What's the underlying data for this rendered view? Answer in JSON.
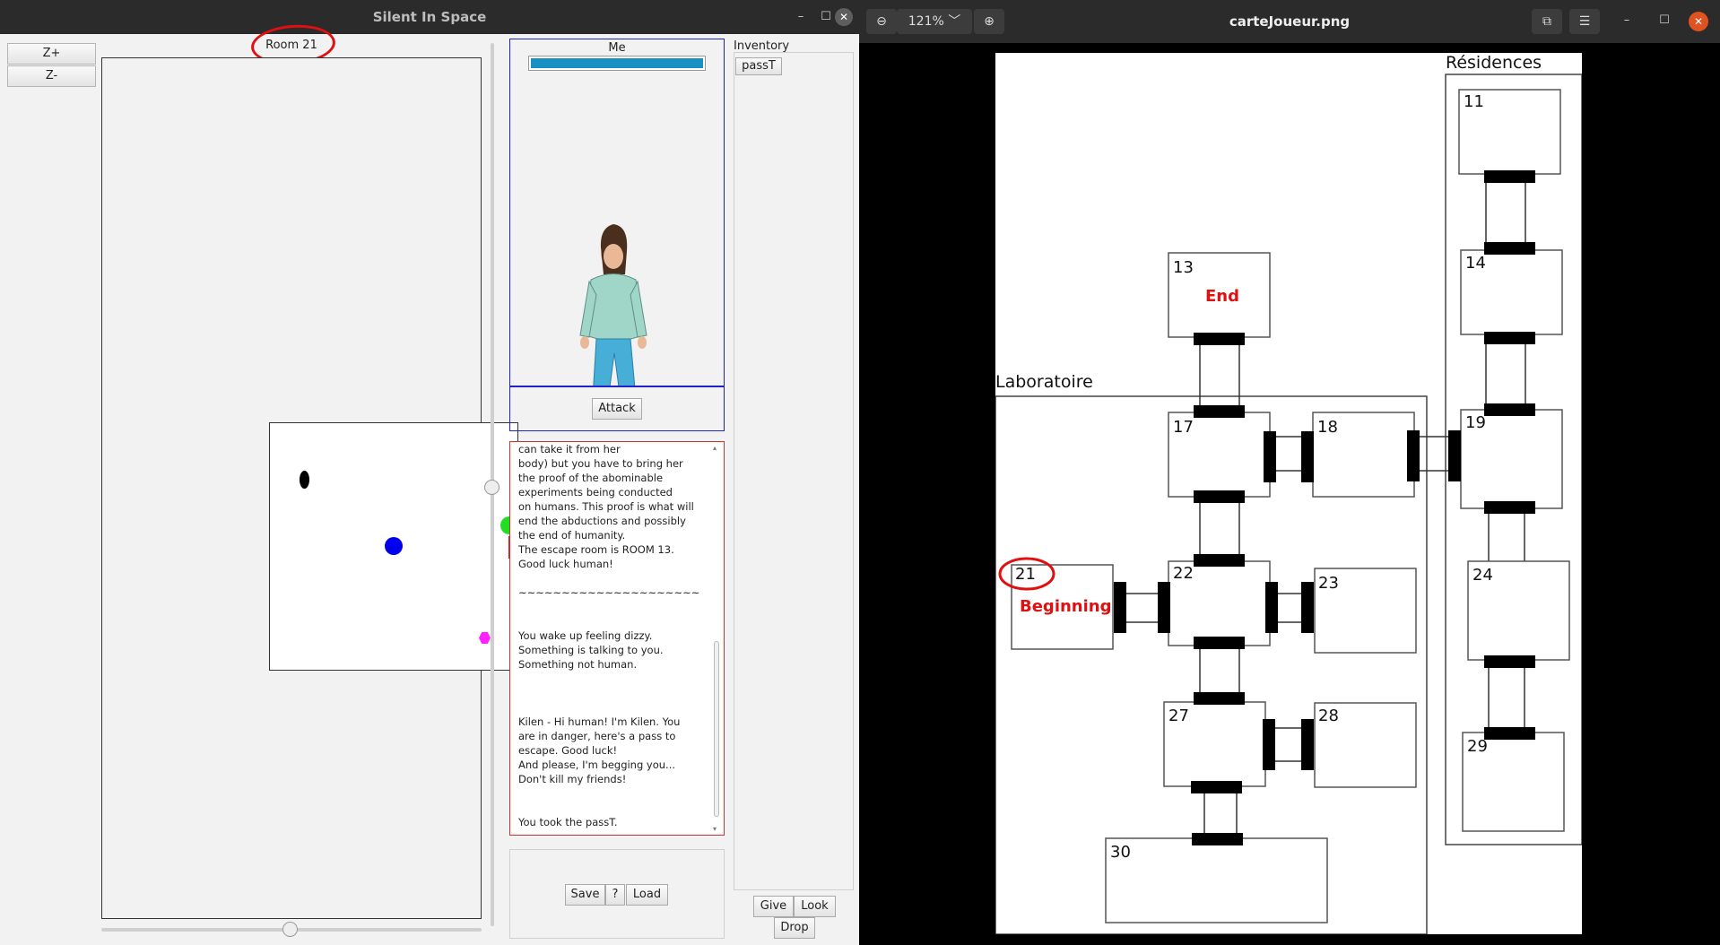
{
  "game_window": {
    "title": "Silent In Space",
    "zoom_in_label": "Z+",
    "zoom_out_label": "Z-",
    "room_label": "Room 21",
    "character_name": "Me",
    "health_fraction": 1.0,
    "attack_label": "Attack",
    "inventory_label": "Inventory",
    "inventory_items": [
      "passT"
    ],
    "save_label": "Save",
    "help_label": "?",
    "load_label": "Load",
    "give_label": "Give",
    "look_label": "Look",
    "drop_label": "Drop",
    "log_lines": [
      "can take it from her",
      "body) but you have to bring her",
      "the proof of the abominable",
      "experiments being conducted",
      "on humans. This proof is what will",
      "end the abductions and possibly",
      "the end of humanity.",
      "The escape room is ROOM 13.",
      "Good luck human!",
      "",
      "~~~~~~~~~~~~~~~~~~~~~",
      "",
      "",
      "You wake up feeling dizzy.",
      "Something is talking to you.",
      "Something not human.",
      "",
      "",
      "",
      "Kilen - Hi human! I'm Kilen. You",
      "are in danger, here's a pass to",
      "escape. Good luck!",
      "And please, I'm begging you...",
      "Don't kill my friends!",
      "",
      "",
      "You took the passT."
    ],
    "entity_colors": {
      "black": "#000000",
      "player": "#0000ee",
      "npc": "#22dd22",
      "door": "#ee1111",
      "item": "#ff22ff"
    }
  },
  "viewer_window": {
    "title": "carteJoueur.png",
    "zoom": "121%",
    "map": {
      "section_labs": "Laboratoire",
      "section_res": "Résidences",
      "rooms": [
        "13",
        "17",
        "18",
        "21",
        "22",
        "23",
        "27",
        "28",
        "30",
        "11",
        "14",
        "19",
        "24",
        "29"
      ],
      "label_end": "End",
      "label_beginning": "Beginning"
    }
  }
}
